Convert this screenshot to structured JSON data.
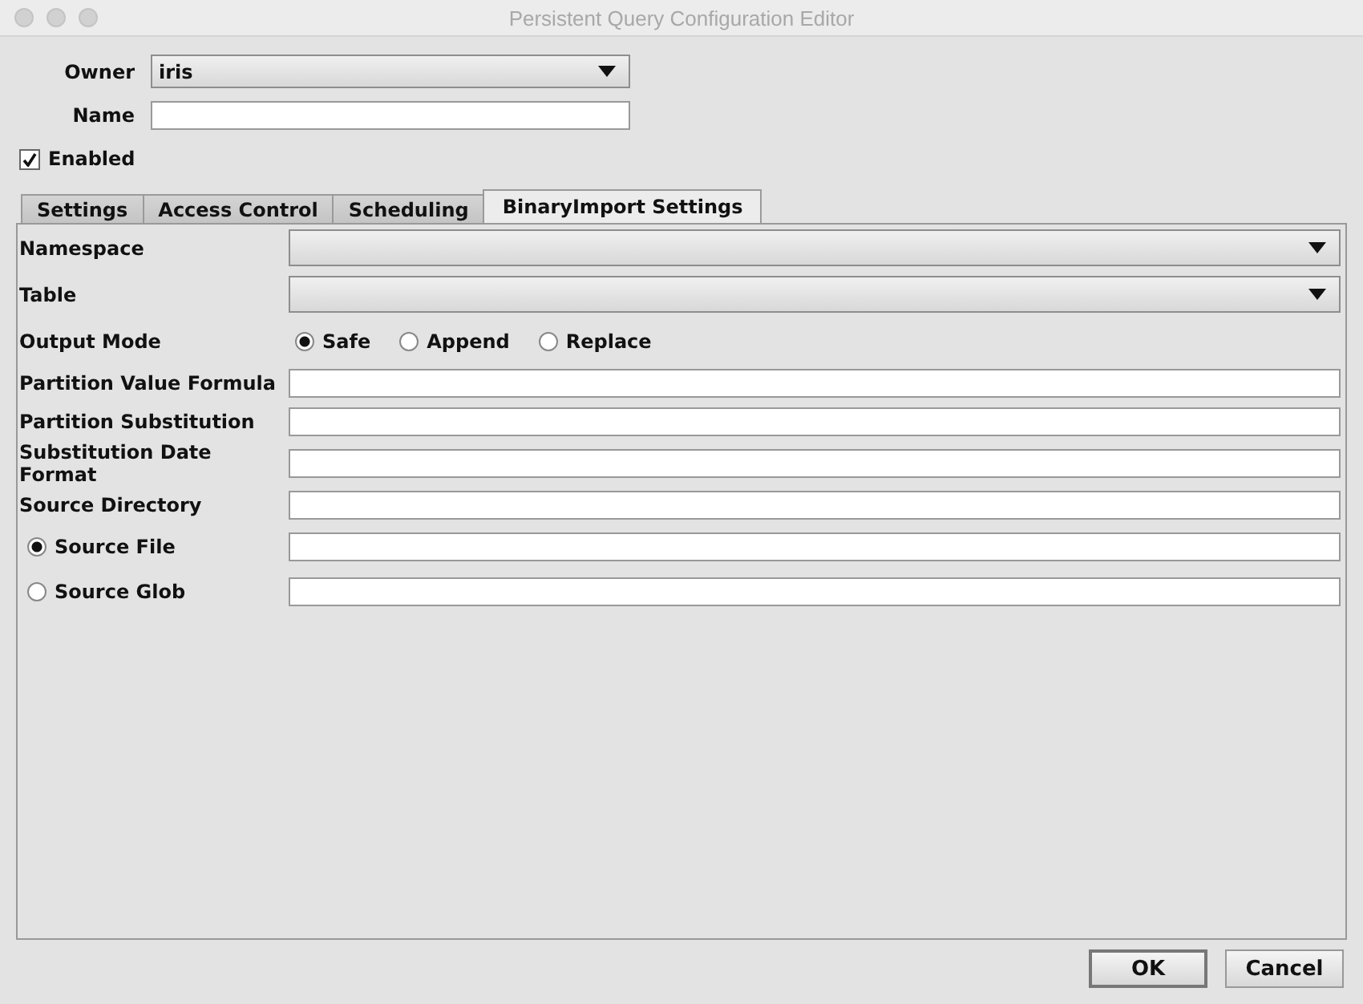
{
  "window": {
    "title": "Persistent Query Configuration Editor"
  },
  "owner": {
    "label": "Owner",
    "value": "iris"
  },
  "name": {
    "label": "Name"
  },
  "enabled": {
    "label": "Enabled",
    "checked": true
  },
  "tabs": [
    {
      "label": "Settings",
      "selected": false
    },
    {
      "label": "Access Control",
      "selected": false
    },
    {
      "label": "Scheduling",
      "selected": false
    },
    {
      "label": "BinaryImport Settings",
      "selected": true
    }
  ],
  "rows": [
    {
      "kind": "combo",
      "label": "Namespace"
    },
    {
      "kind": "combo",
      "label": "Table"
    },
    {
      "kind": "radios",
      "label": "Output Mode",
      "options": [
        {
          "label": "Safe",
          "selected": true
        },
        {
          "label": "Append",
          "selected": false
        },
        {
          "label": "Replace",
          "selected": false
        }
      ]
    },
    {
      "kind": "text",
      "label": "Partition Value Formula"
    },
    {
      "kind": "text",
      "label": "Partition Substitution"
    },
    {
      "kind": "text",
      "label": "Substitution Date Format"
    },
    {
      "kind": "text",
      "label": "Source Directory"
    },
    {
      "kind": "radio-text",
      "label": "Source File",
      "selected": true
    },
    {
      "kind": "radio-text",
      "label": "Source Glob",
      "selected": false
    }
  ],
  "buttons": [
    "OK",
    "Cancel"
  ]
}
